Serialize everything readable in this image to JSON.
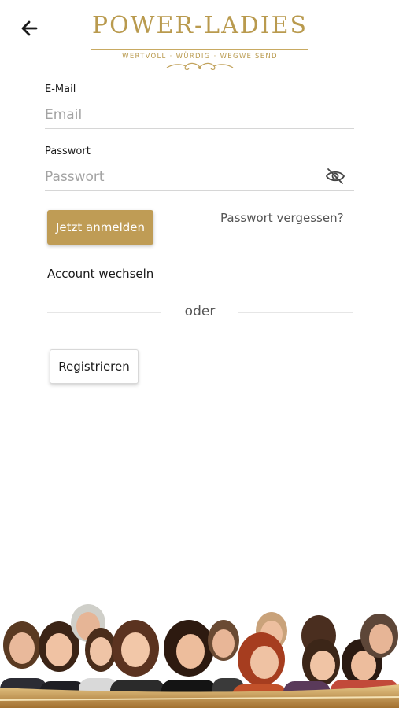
{
  "header": {
    "back_icon": "arrow-left-icon",
    "logo_title": "POWER-LADIES",
    "logo_tagline": "WERTVOLL · WÜRDIG · WEGWEISEND",
    "brand_color": "#b99a4e"
  },
  "form": {
    "email_label": "E-Mail",
    "email_placeholder": "Email",
    "email_value": "",
    "password_label": "Passwort",
    "password_placeholder": "Passwort",
    "password_value": "",
    "password_toggle_icon": "eye-off-icon"
  },
  "actions": {
    "login_label": "Jetzt anmelden",
    "forgot_label": "Passwort vergessen?",
    "switch_account_label": "Account wechseln",
    "divider_label": "oder",
    "register_label": "Registrieren",
    "accent_color": "#bf9c55"
  },
  "footer": {
    "image": "group-photo-women"
  }
}
